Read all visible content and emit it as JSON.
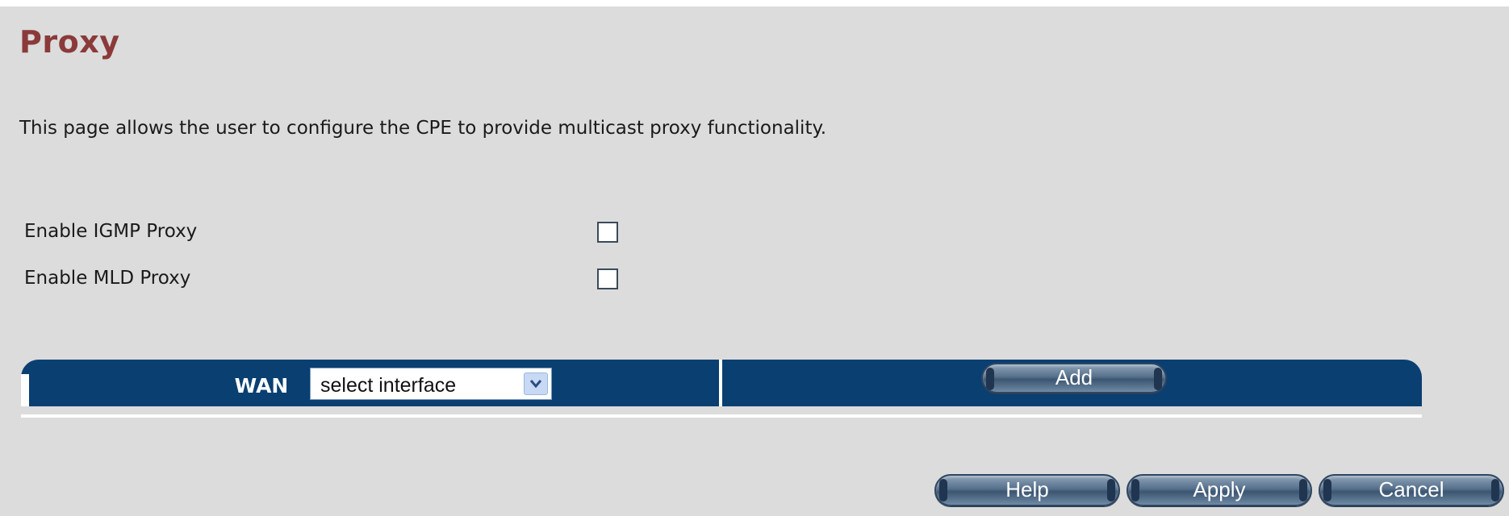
{
  "page": {
    "title": "Proxy",
    "description": "This page allows the user to configure the CPE to provide multicast proxy functionality."
  },
  "options": [
    {
      "label": "Enable IGMP Proxy",
      "checked": false
    },
    {
      "label": "Enable MLD Proxy",
      "checked": false
    }
  ],
  "wan": {
    "label": "WAN",
    "select_value": "select interface",
    "add_label": "Add"
  },
  "footer": {
    "help_label": "Help",
    "apply_label": "Apply",
    "cancel_label": "Cancel"
  },
  "colors": {
    "title": "#8b3a3a",
    "bar": "#0a3f72",
    "background": "#dcdcdc"
  }
}
